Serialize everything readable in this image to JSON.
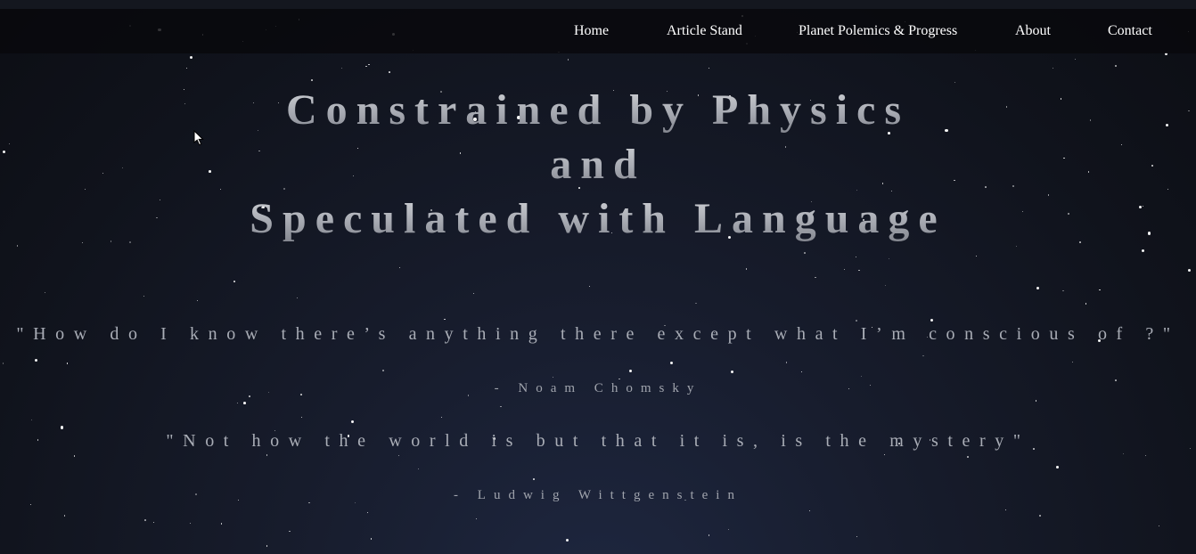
{
  "nav": {
    "items": [
      {
        "label": "Home"
      },
      {
        "label": "Article Stand"
      },
      {
        "label": "Planet Polemics & Progress"
      },
      {
        "label": "About"
      },
      {
        "label": "Contact"
      }
    ]
  },
  "hero": {
    "title_line1": "Constrained by Physics",
    "title_line2": "and",
    "title_line3": "Speculated with Language"
  },
  "quotes": [
    {
      "text": "\"How do I know there’s anything there except what I’m conscious of ?\"",
      "author": "- Noam Chomsky"
    },
    {
      "text": "\"Not how the world is but that it is, is the mystery\"",
      "author": "- Ludwig Wittgenstein"
    }
  ],
  "theme": {
    "background": "#10131c",
    "navbar": "#08090c",
    "text": "#ffffff",
    "title": "#c7c9cf",
    "quote": "#a9adb6"
  }
}
